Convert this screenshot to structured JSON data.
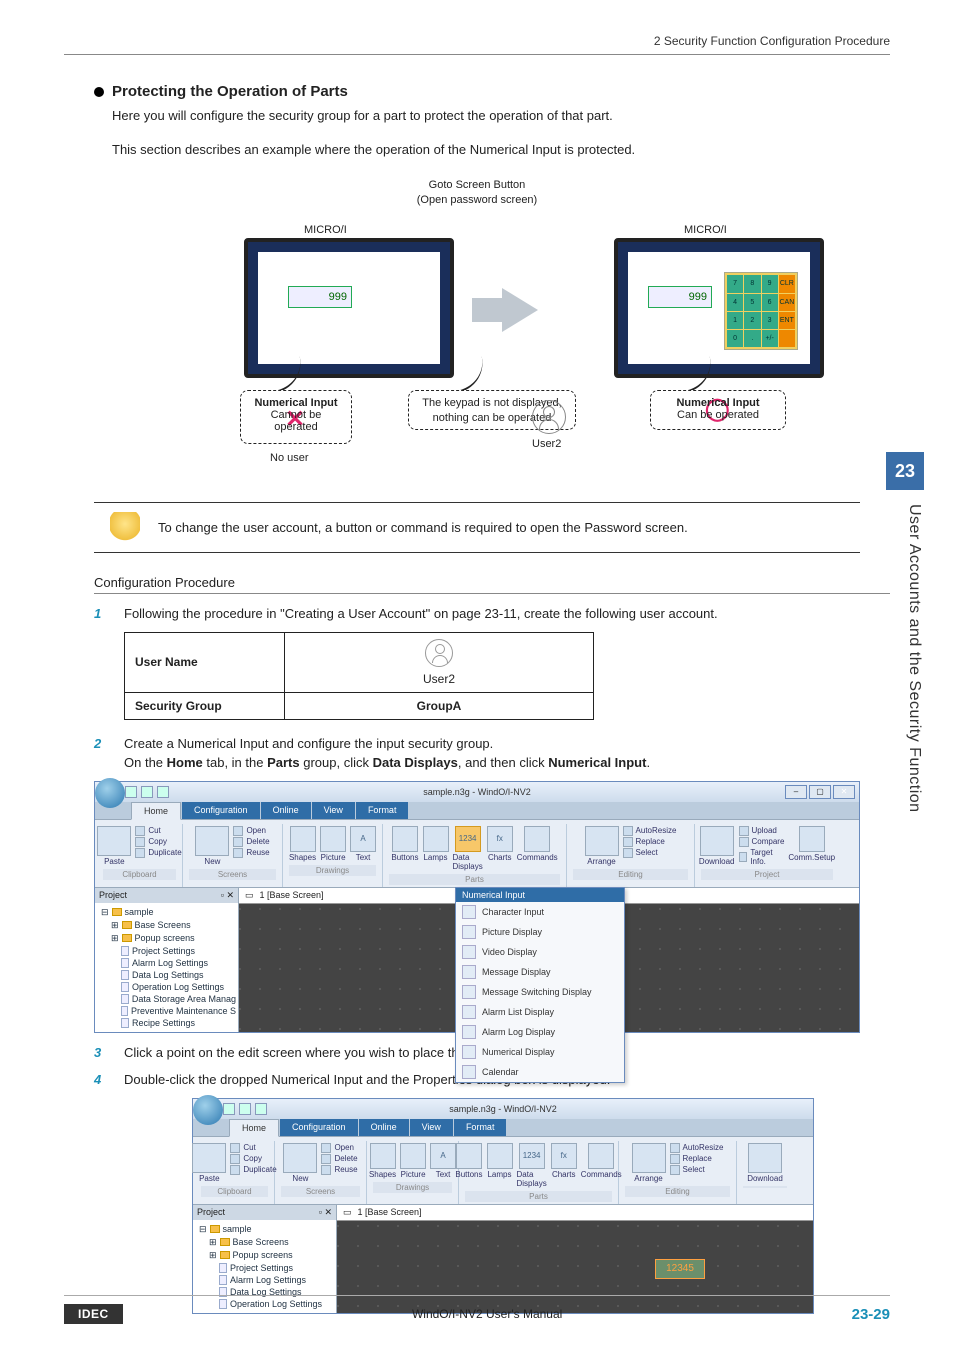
{
  "breadcrumb": "2 Security Function Configuration Procedure",
  "section_title": "Protecting the Operation of Parts",
  "intro_line1": "Here you will configure the security group for a part to protect the operation of that part.",
  "intro_line2": "This section describes an example where the operation of the Numerical Input is protected.",
  "diagram": {
    "goto_l1": "Goto Screen Button",
    "goto_l2": "(Open password screen)",
    "microi": "MICRO/I",
    "numval": "999",
    "ni_title": "Numerical Input",
    "cannot_l1": "Cannot be",
    "cannot_l2": "operated",
    "keypad_msg_l1": "The keypad is not displayed,",
    "keypad_msg_l2": "nothing can be operated",
    "can_l1": "Can be operated",
    "no_user": "No user",
    "user2": "User2",
    "keys": [
      "7",
      "8",
      "9",
      "CLR",
      "4",
      "5",
      "6",
      "CAN",
      "1",
      "2",
      "3",
      "ENT",
      "0",
      ".",
      "+/-",
      ""
    ]
  },
  "tip": "To change the user account, a button or command is required to open the Password screen.",
  "config_head": "Configuration Procedure",
  "steps": {
    "s1": "Following the procedure in \"Creating a User Account\" on page 23-11, create the following user account.",
    "s2_a": "Create a Numerical Input and configure the input security group.",
    "s2_b_pre": "On the ",
    "s2_b_home": "Home",
    "s2_b_mid1": " tab, in the ",
    "s2_b_parts": "Parts",
    "s2_b_mid2": " group, click ",
    "s2_b_dd": "Data Displays",
    "s2_b_mid3": ", and then click ",
    "s2_b_ni": "Numerical Input",
    "s2_b_end": ".",
    "s3": "Click a point on the edit screen where you wish to place the Numerical Input.",
    "s4": "Double-click the dropped Numerical Input and the Properties dialog box is displayed."
  },
  "table": {
    "h_user": "User Name",
    "h_group": "Security Group",
    "user": "User2",
    "group": "GroupA"
  },
  "app": {
    "title": "sample.n3g - WindO/I-NV2",
    "tabs": [
      "Home",
      "Configuration",
      "Online",
      "View",
      "Format"
    ],
    "clip": {
      "cut": "Cut",
      "copy": "Copy",
      "paste": "Paste",
      "dup": "Duplicate",
      "label": "Clipboard"
    },
    "screens": {
      "new": "New",
      "open": "Open",
      "delete": "Delete",
      "reuse": "Reuse",
      "label": "Screens"
    },
    "drawings": {
      "shapes": "Shapes",
      "picture": "Picture",
      "text": "Text",
      "label": "Drawings"
    },
    "parts": {
      "buttons": "Buttons",
      "lamps": "Lamps",
      "data": "Data\nDisplays",
      "charts": "Charts",
      "commands": "Commands",
      "label": "Parts"
    },
    "editing": {
      "arrange": "Arrange",
      "autoresize": "AutoResize",
      "replace": "Replace",
      "select": "Select",
      "label": "Editing"
    },
    "project": {
      "download": "Download",
      "upload": "Upload",
      "compare": "Compare",
      "target": "Target Info.",
      "comm": "Comm.Setup",
      "label": "Project"
    },
    "dd_header": "Numerical Input",
    "dd_items": [
      "Character Input",
      "Picture Display",
      "Video Display",
      "Message Display",
      "Message Switching Display",
      "Alarm List Display",
      "Alarm Log Display",
      "Numerical Display",
      "Calendar"
    ],
    "proj_hdr": "Project",
    "canvas_hdr": "1  [Base Screen]",
    "tree": {
      "root": "sample",
      "items": [
        "Base Screens",
        "Popup screens",
        "Project Settings",
        "Alarm Log Settings",
        "Data Log Settings",
        "Operation Log Settings",
        "Data Storage Area Manag",
        "Preventive Maintenance S",
        "Recipe Settings"
      ]
    },
    "placed_val": "12345"
  },
  "chapter_num": "23",
  "side_text": "User Accounts and the Security Function",
  "footer": {
    "logo": "IDEC",
    "center": "WindO/I-NV2 User's Manual",
    "page": "23-29"
  }
}
